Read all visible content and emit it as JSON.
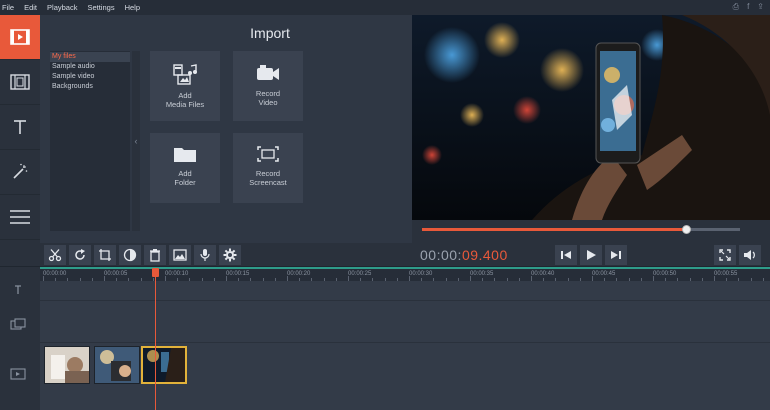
{
  "menu": {
    "items": [
      "File",
      "Edit",
      "Playback",
      "Settings",
      "Help"
    ],
    "right_icons": [
      "printer-icon",
      "facebook-icon",
      "share-icon"
    ]
  },
  "tools": [
    "film-icon",
    "filmstrip-icon",
    "text-icon",
    "magic-wand-icon",
    "menu-icon"
  ],
  "import": {
    "title": "Import",
    "files": [
      "My files",
      "Sample audio",
      "Sample video",
      "Backgrounds"
    ],
    "tiles": [
      {
        "label": "Add\nMedia Files",
        "icon": "media-files-icon"
      },
      {
        "label": "Record\nVideo",
        "icon": "camera-icon"
      },
      {
        "label": "Add\nFolder",
        "icon": "folder-icon"
      },
      {
        "label": "Record\nScreencast",
        "icon": "screencast-icon"
      }
    ]
  },
  "player": {
    "timecode_base": "00:00:",
    "timecode_accent": "09.400",
    "progress": 0.83
  },
  "timeline": {
    "ruler_labels": [
      "00:00:00",
      "00:00:05",
      "00:00:10",
      "00:00:15",
      "00:00:20",
      "00:00:25",
      "00:00:30",
      "00:00:35",
      "00:00:40",
      "00:00:45",
      "00:00:50",
      "00:00:55"
    ]
  },
  "colors": {
    "accent": "#e8593a",
    "selected_clip": "#e2b23a",
    "ruler_line": "#2e9c8a"
  }
}
